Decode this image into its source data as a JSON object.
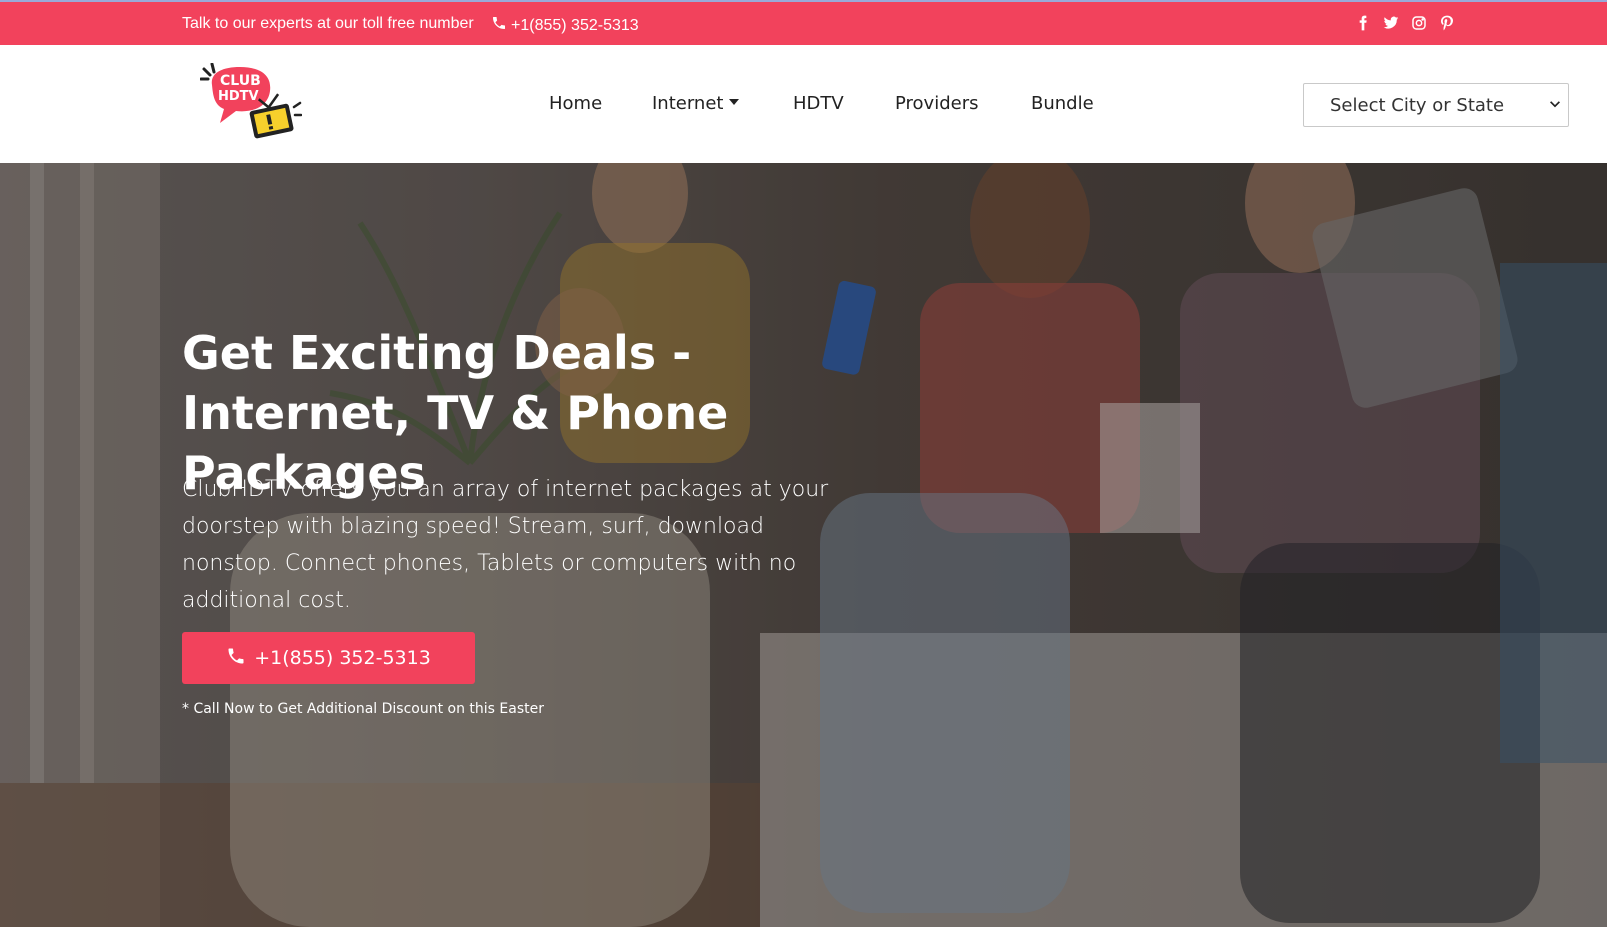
{
  "topbar": {
    "message": "Talk to our experts at our toll free number",
    "phone": "+1(855) 352-5313",
    "social": [
      "facebook-icon",
      "twitter-icon",
      "instagram-icon",
      "pinterest-icon"
    ]
  },
  "brand": {
    "logo_line1": "CLUB",
    "logo_line2": "HDTV"
  },
  "nav": {
    "items": [
      "Home",
      "Internet",
      "HDTV",
      "Providers",
      "Bundle"
    ],
    "select_value": "Select City or State"
  },
  "hero": {
    "title": "Get Exciting Deals - Internet, TV & Phone Packages",
    "text": "ClubHDTV offers you an array of internet packages at your doorstep with blazing speed! Stream, surf, download nonstop. Connect phones, Tablets or computers with no additional cost.",
    "cta_phone": "+1(855) 352-5313",
    "note": "* Call Now to Get Additional Discount on this Easter"
  },
  "colors": {
    "accent": "#f2425c",
    "text_dark": "#222222"
  }
}
